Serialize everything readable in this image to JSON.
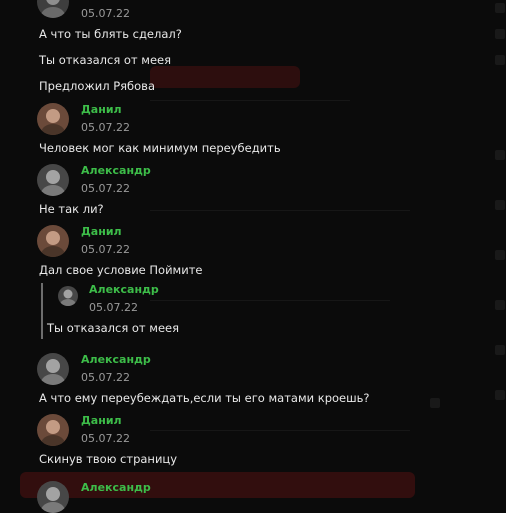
{
  "colors": {
    "author": "#3dbd49",
    "date": "#9a9a9a",
    "text": "#e9e9e9",
    "background": "#0b0b0b",
    "underlay_accent": "#5a1313"
  },
  "messages": [
    {
      "avatar": "avatar-photo",
      "date": "05.07.22",
      "lines": [
        "А что ты блять сделал?",
        "Ты отказался от меея",
        "Предложил Рябова"
      ]
    },
    {
      "author": "Данил",
      "avatar": "avatar-photo",
      "date": "05.07.22",
      "lines": [
        "Человек мог как минимум переубедить"
      ]
    },
    {
      "author": "Александр",
      "avatar": "avatar-photo",
      "date": "05.07.22",
      "lines": [
        "Не так ли?"
      ]
    },
    {
      "author": "Данил",
      "avatar": "avatar-photo",
      "date": "05.07.22",
      "lines": [
        "Дал свое условие Поймите"
      ],
      "quote": {
        "author": "Александр",
        "date": "05.07.22",
        "text": "Ты отказался от меея"
      }
    },
    {
      "author": "Александр",
      "avatar": "avatar-photo",
      "date": "05.07.22",
      "lines": [
        "А что ему переубеждать,если ты его матами кроешь?"
      ]
    },
    {
      "author": "Данил",
      "avatar": "avatar-photo",
      "date": "05.07.22",
      "lines": [
        "Скинув твою страницу"
      ]
    },
    {
      "author": "Александр",
      "avatar": "avatar-photo"
    }
  ]
}
